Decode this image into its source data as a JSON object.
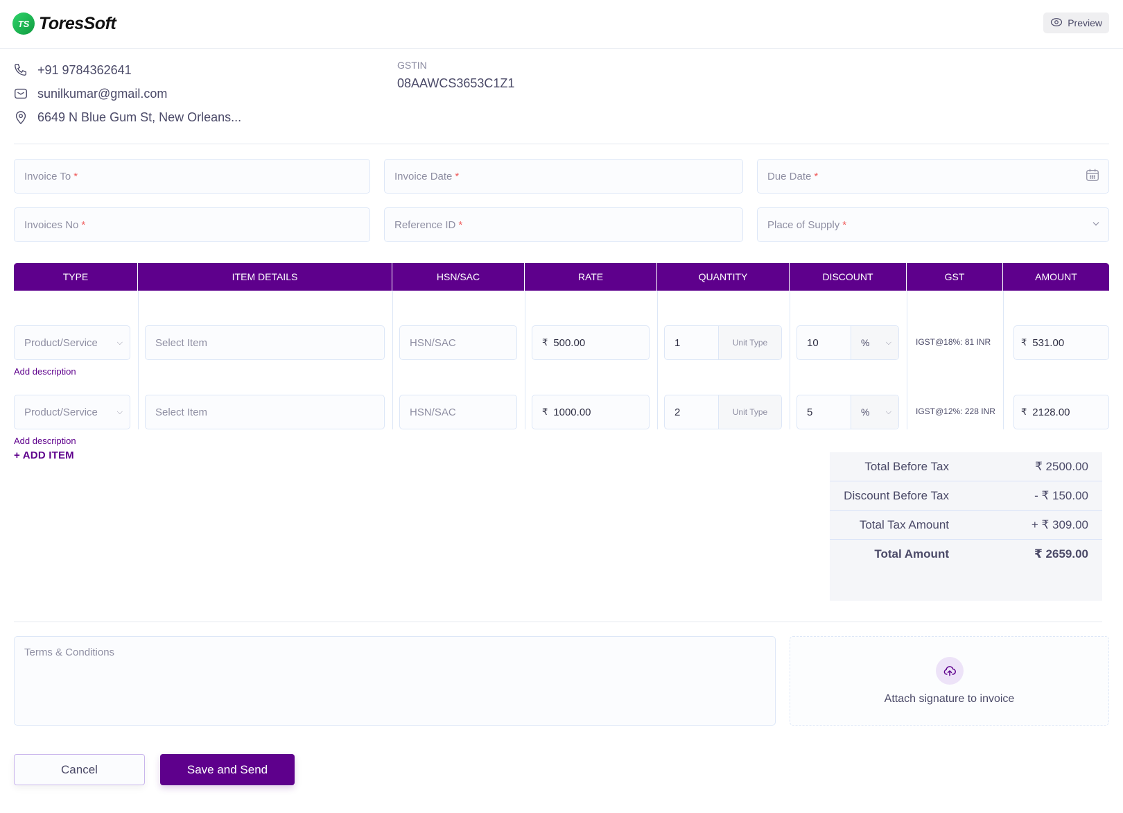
{
  "header": {
    "logo_mark": "TS",
    "logo_text": "ToresSoft",
    "preview_label": "Preview"
  },
  "company": {
    "phone": "+91 9784362641",
    "email": "sunilkumar@gmail.com",
    "address": "6649 N Blue Gum St, New Orleans...",
    "gstin_label": "GSTIN",
    "gstin_value": "08AAWCS3653C1Z1"
  },
  "form": {
    "invoice_to": "Invoice To",
    "invoice_date": "Invoice Date",
    "due_date": "Due Date",
    "invoice_no": "Invoices No",
    "reference_id": "Reference ID",
    "place_of_supply": "Place of Supply",
    "required_mark": "*"
  },
  "table": {
    "columns": [
      "TYPE",
      "ITEM DETAILS",
      "HSN/SAC",
      "RATE",
      "QUANTITY",
      "DISCOUNT",
      "GST",
      "AMOUNT"
    ],
    "currency": "₹",
    "rows": [
      {
        "type_placeholder": "Product/Service",
        "item_placeholder": "Select Item",
        "hsn_placeholder": "HSN/SAC",
        "rate": "500.00",
        "quantity": "1",
        "unit_type": "Unit Type",
        "discount": "10",
        "discount_unit": "%",
        "gst": "IGST@18%: 81 INR",
        "amount": "531.00",
        "add_description": "Add description"
      },
      {
        "type_placeholder": "Product/Service",
        "item_placeholder": "Select Item",
        "hsn_placeholder": "HSN/SAC",
        "rate": "1000.00",
        "quantity": "2",
        "unit_type": "Unit Type",
        "discount": "5",
        "discount_unit": "%",
        "gst": "IGST@12%: 228 INR",
        "amount": "2128.00",
        "add_description": "Add description"
      }
    ],
    "add_item_label": "+ ADD ITEM"
  },
  "summary": [
    {
      "label": "Total Before Tax",
      "value": "₹ 2500.00"
    },
    {
      "label": "Discount Before Tax",
      "value": "- ₹ 150.00"
    },
    {
      "label": "Total Tax Amount",
      "value": "+ ₹ 309.00"
    },
    {
      "label": "Total Amount",
      "value": "₹ 2659.00"
    }
  ],
  "footer": {
    "terms_placeholder": "Terms & Conditions",
    "attach_signature": "Attach signature to invoice",
    "cancel_label": "Cancel",
    "save_label": "Save and Send"
  },
  "colors": {
    "brand": "#5e008c",
    "logo_green": "#1ec25a",
    "required": "#f05c5c"
  }
}
